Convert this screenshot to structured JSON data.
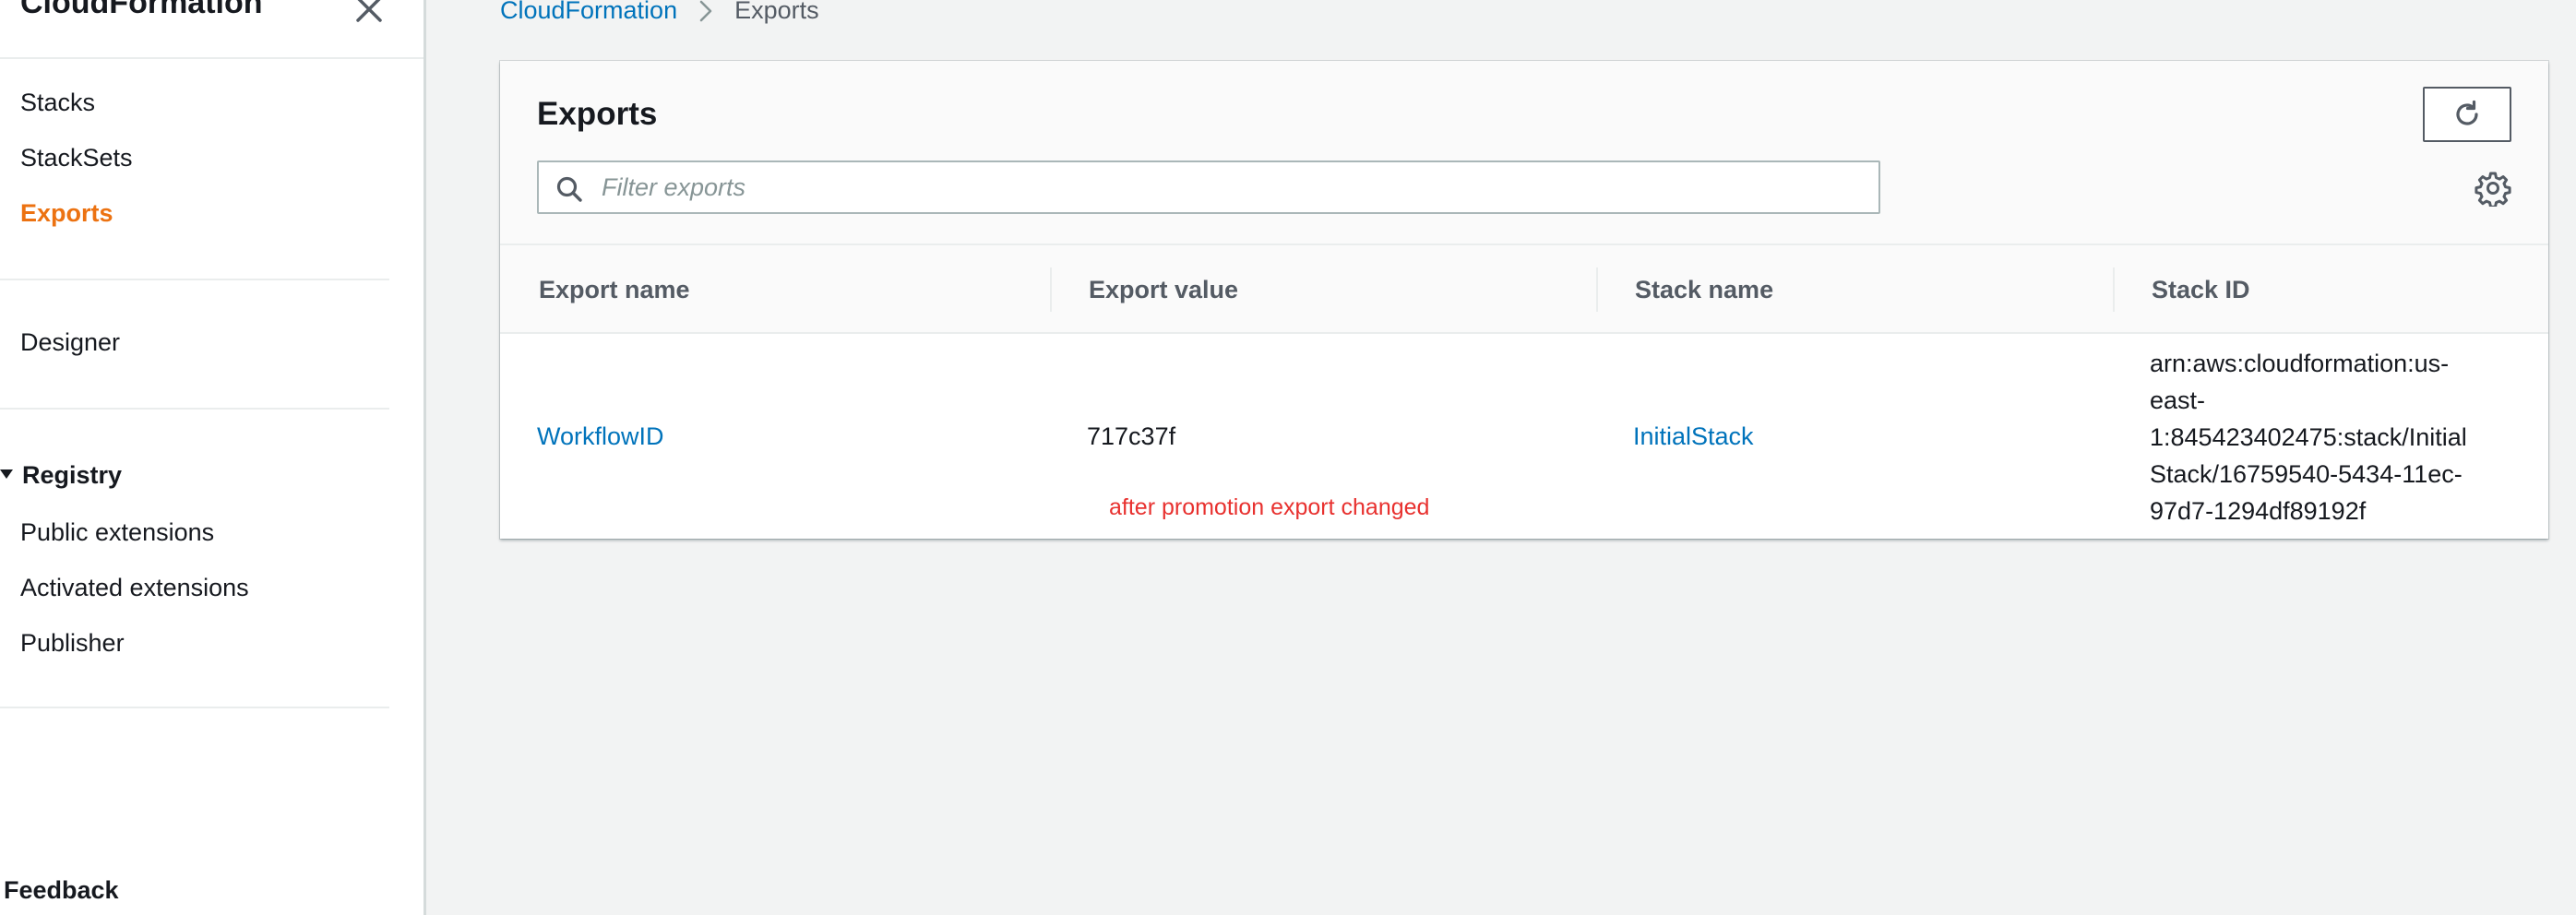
{
  "sidebar": {
    "title": "CloudFormation",
    "items": [
      {
        "label": "Stacks"
      },
      {
        "label": "StackSets"
      },
      {
        "label": "Exports"
      },
      {
        "label": "Designer"
      }
    ],
    "registry": {
      "heading": "Registry",
      "items": [
        {
          "label": "Public extensions"
        },
        {
          "label": "Activated extensions"
        },
        {
          "label": "Publisher"
        }
      ]
    },
    "feedback": "Feedback"
  },
  "breadcrumb": {
    "root": "CloudFormation",
    "current": "Exports"
  },
  "panel": {
    "title": "Exports",
    "search_placeholder": "Filter exports"
  },
  "table": {
    "columns": [
      "Export name",
      "Export value",
      "Stack name",
      "Stack ID"
    ],
    "rows": [
      {
        "export_name": "WorkflowID",
        "export_value": "717c37f",
        "stack_name": "InitialStack",
        "stack_id_lines": [
          "arn:aws:cloudformation:us-",
          "east-",
          "1:845423402475:stack/Initial",
          "Stack/16759540-5434-11ec-",
          "97d7-1294df89192f"
        ]
      }
    ]
  },
  "annotation": "after promotion export changed",
  "colors": {
    "accent_active": "#ec7211",
    "link": "#0073bb",
    "annotation": "#e8312f"
  },
  "icons": {
    "close": "close-icon",
    "refresh": "refresh-icon",
    "search": "search-icon",
    "settings": "gear-icon",
    "breadcrumb_separator": "chevron-right-icon",
    "section_toggle": "caret-down-icon"
  }
}
